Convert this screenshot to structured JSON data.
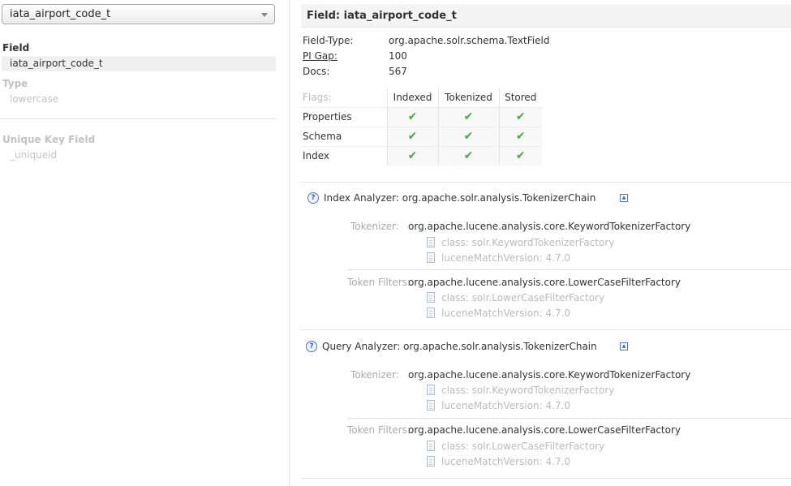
{
  "field_select": {
    "value": "iata_airport_code_t",
    "icon": "chevron-down-icon"
  },
  "sidebar": {
    "field_label": "Field",
    "field_value": "iata_airport_code_t",
    "type_label": "Type",
    "type_value": "lowercase",
    "unique_key_label": "Unique Key Field",
    "unique_key_value": "_uniqueid"
  },
  "header": {
    "title": "Field: iata_airport_code_t"
  },
  "meta": [
    {
      "key": "Field-Type:",
      "value": "org.apache.solr.schema.TextField"
    },
    {
      "key": "PI Gap:",
      "value": "100"
    },
    {
      "key": "Docs:",
      "value": "567"
    }
  ],
  "flags": {
    "label": "Flags:",
    "columns": [
      "Indexed",
      "Tokenized",
      "Stored"
    ],
    "rows": [
      {
        "name": "Properties",
        "values": [
          true,
          true,
          true
        ]
      },
      {
        "name": "Schema",
        "values": [
          true,
          true,
          true
        ]
      },
      {
        "name": "Index",
        "values": [
          true,
          true,
          true
        ]
      }
    ],
    "check_glyph": "✔",
    "check_color": "#3fae3f"
  },
  "analyzers": [
    {
      "title": "Index Analyzer:",
      "class": "org.apache.solr.analysis.TokenizerChain",
      "tokenizer_label": "Tokenizer:",
      "tokenizer": "org.apache.lucene.analysis.core.KeywordTokenizerFactory",
      "tokenizer_props": [
        "class: solr.KeywordTokenizerFactory",
        "luceneMatchVersion: 4.7.0"
      ],
      "filter_label": "Token Filters:",
      "filter": "org.apache.lucene.analysis.core.LowerCaseFilterFactory",
      "filter_props": [
        "class: solr.LowerCaseFilterFactory",
        "luceneMatchVersion: 4.7.0"
      ]
    },
    {
      "title": "Query Analyzer:",
      "class": "org.apache.solr.analysis.TokenizerChain",
      "tokenizer_label": "Tokenizer:",
      "tokenizer": "org.apache.lucene.analysis.core.KeywordTokenizerFactory",
      "tokenizer_props": [
        "class: solr.KeywordTokenizerFactory",
        "luceneMatchVersion: 4.7.0"
      ],
      "filter_label": "Token Filters:",
      "filter": "org.apache.lucene.analysis.core.LowerCaseFilterFactory",
      "filter_props": [
        "class: solr.LowerCaseFilterFactory",
        "luceneMatchVersion: 4.7.0"
      ]
    }
  ],
  "icons": {
    "help": "?",
    "collapse": "▲"
  }
}
